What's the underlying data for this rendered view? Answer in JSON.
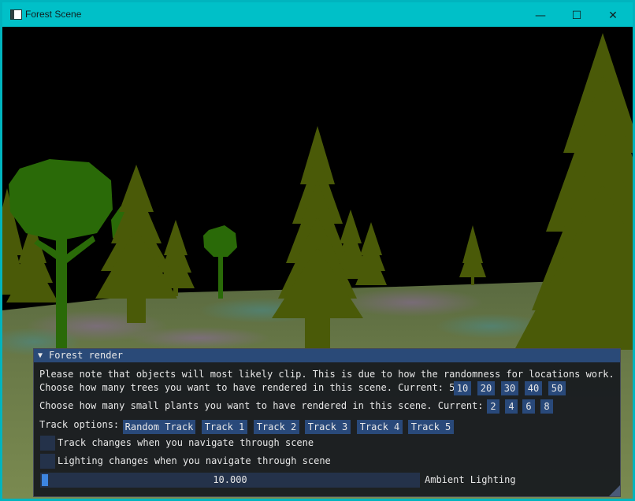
{
  "window": {
    "title": "Forest Scene",
    "minimize": "—",
    "maximize": "☐",
    "close": "✕"
  },
  "panel": {
    "title": "Forest render",
    "note": "Please note that objects will most likely clip. This is due to how the randomness for locations work.",
    "trees_label": "Choose how many trees you want to have rendered in this scene. Current: 50",
    "tree_options": [
      "10",
      "20",
      "30",
      "40",
      "50"
    ],
    "plants_label": "Choose how many small plants you want to have rendered in this scene. Current: 8",
    "plant_options": [
      "2",
      "4",
      "6",
      "8"
    ],
    "track_label": "Track options:",
    "track_buttons": [
      "Random Track",
      "Track 1",
      "Track 2",
      "Track 3",
      "Track 4",
      "Track 5"
    ],
    "track_changes_label": "Track changes when you navigate through scene",
    "lighting_changes_label": "Lighting changes when you navigate through scene",
    "ambient_value": "10.000",
    "ambient_fraction": 0.0,
    "ambient_label": "Ambient Lighting"
  },
  "colors": {
    "tree": "#4a5a08",
    "leaf_tree": "#2a6a08",
    "button": "#29497a",
    "header": "#2a4a78"
  }
}
